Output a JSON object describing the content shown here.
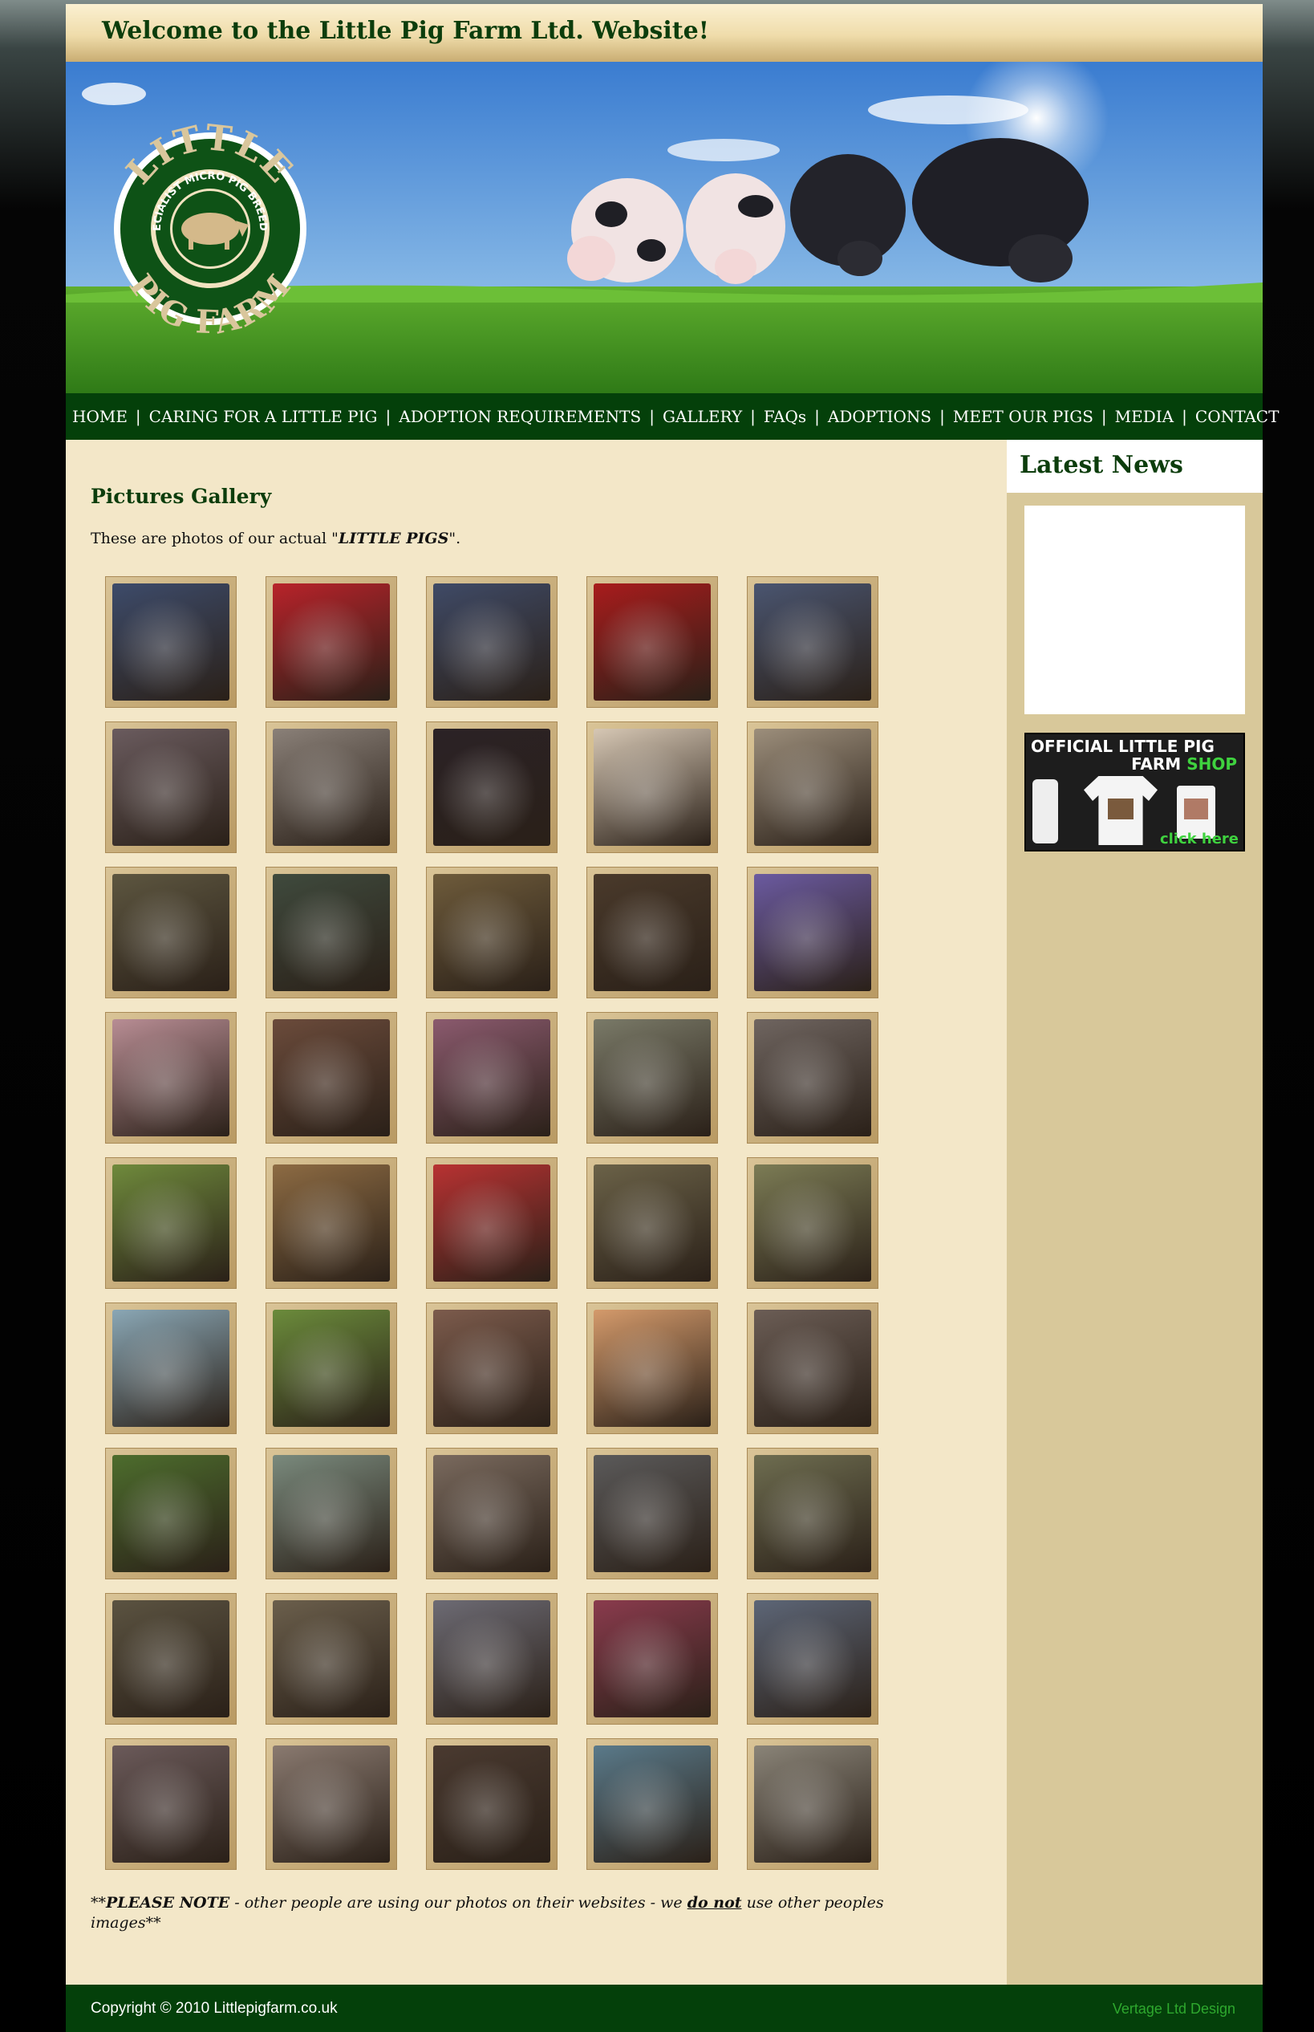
{
  "header": {
    "title": "Welcome to the Little Pig Farm Ltd. Website!"
  },
  "logo": {
    "top_text": "LITTLE",
    "ring_text": "SPECIALIST MICRO PIG BREEDER",
    "bottom_text": "PIG FARM"
  },
  "nav": {
    "items": [
      "HOME",
      "CARING FOR A LITTLE PIG",
      "ADOPTION REQUIREMENTS",
      "GALLERY",
      "FAQs",
      "ADOPTIONS",
      "MEET OUR PIGS",
      "MEDIA",
      "CONTACT"
    ],
    "separator": "|"
  },
  "main": {
    "title": "Pictures Gallery",
    "intro_prefix": "These are photos of our actual \"",
    "intro_emphasis": "LITTLE PIGS",
    "intro_suffix": "\".",
    "note_part1": "**",
    "note_part2": "PLEASE NOTE",
    "note_part3": " - other people are using our photos on their websites - we ",
    "note_part4": "do not",
    "note_part5": " use other peoples images**"
  },
  "gallery": {
    "rows": 9,
    "cols": 5,
    "photo_palette": [
      "#3d4b6a",
      "#b8232a",
      "#3f4a66",
      "#a81c1c",
      "#4a5570",
      "#6a5b5e",
      "#8a8078",
      "#2b2226",
      "#d6c7b4",
      "#9c8e7b",
      "#5d5640",
      "#3f4a3d",
      "#6e5b3b",
      "#4a3a2b",
      "#6b5aa0",
      "#b88d94",
      "#6b4b3b",
      "#8b5a6e",
      "#7a7a68",
      "#6f6560",
      "#6f8a3c",
      "#8d6b43",
      "#b83232",
      "#6b6248",
      "#7c7c55",
      "#8aa7b5",
      "#6b8b3b",
      "#7c5b4c",
      "#d49a6b",
      "#6b5d55",
      "#4d6d2d",
      "#7a8a7d",
      "#7a6a5e",
      "#5b5a5a",
      "#6e6d50",
      "#5b5341",
      "#6b5f4c",
      "#6d6b74",
      "#8a3b4d",
      "#5d6677",
      "#6b5a5a",
      "#8a7a70",
      "#4a3a30",
      "#5a7a8a",
      "#8a8478"
    ]
  },
  "sidebar": {
    "news_heading": "Latest News",
    "shop_line1": "OFFICIAL LITTLE PIG",
    "shop_line2a": "FARM ",
    "shop_line2b": "SHOP",
    "shop_click": "click here"
  },
  "footer": {
    "copyright": "Copyright © 2010 Littlepigfarm.co.uk",
    "credit": "Vertage Ltd Design"
  },
  "colors": {
    "dark_green": "#04400a",
    "content_bg": "#f3e7c8",
    "sidebar_bg": "#d8c89a",
    "title_green": "#0c3d0c"
  }
}
